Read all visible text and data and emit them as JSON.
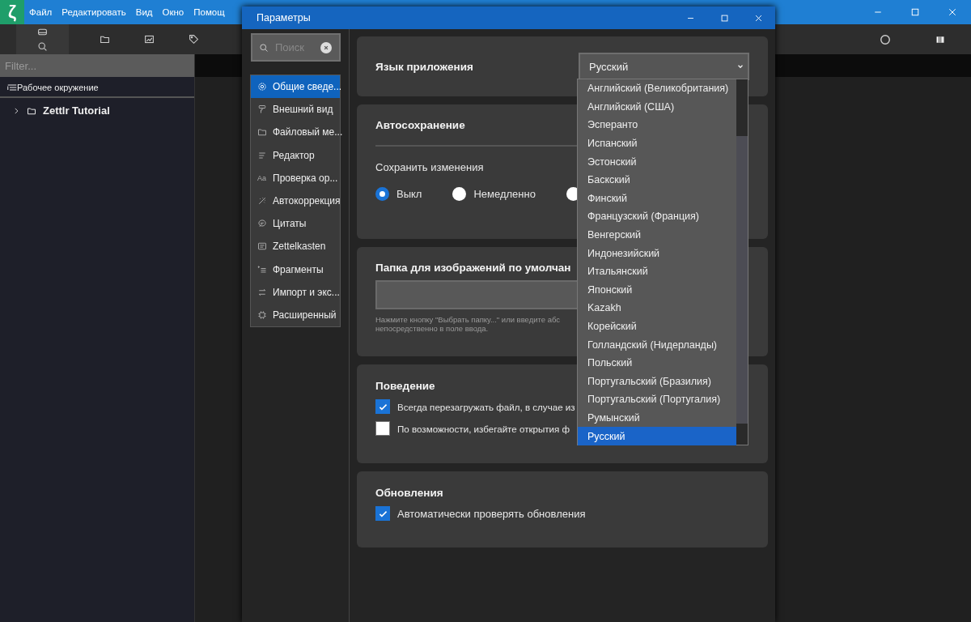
{
  "app": {
    "logo": "ζ",
    "menu": [
      "Файл",
      "Редактировать",
      "Вид",
      "Окно",
      "Помощ"
    ],
    "filter": {
      "placeholder": "Filter..."
    },
    "workspace_header": "Рабочее окружение",
    "tree": [
      {
        "label": "Zettlr Tutorial",
        "expanded": false
      }
    ]
  },
  "dialog": {
    "title": "Параметры",
    "search": {
      "placeholder": "Поиск"
    },
    "nav": [
      {
        "label": "Общие сведе...",
        "kind": "gear",
        "selected": true
      },
      {
        "label": "Внешний вид",
        "kind": "roller",
        "selected": false
      },
      {
        "label": "Файловый ме...",
        "kind": "folder",
        "selected": false
      },
      {
        "label": "Редактор",
        "kind": "lines",
        "selected": false
      },
      {
        "label": "Проверка ор...",
        "kind": "text",
        "icon_text": "Aa",
        "selected": false
      },
      {
        "label": "Автокоррекция",
        "kind": "wand",
        "selected": false
      },
      {
        "label": "Цитаты",
        "kind": "quote",
        "selected": false
      },
      {
        "label": "Zettelkasten",
        "kind": "note",
        "selected": false
      },
      {
        "label": "Фрагменты",
        "kind": "fragments",
        "selected": false
      },
      {
        "label": "Импорт и экс...",
        "kind": "arrows",
        "selected": false
      },
      {
        "label": "Расширенный",
        "kind": "chip",
        "selected": false
      }
    ],
    "language": {
      "title": "Язык приложения",
      "value": "Русский",
      "options": [
        {
          "label": "Английский (Великобритания)",
          "selected": false
        },
        {
          "label": "Английский (США)",
          "selected": false
        },
        {
          "label": "Эсперанто",
          "selected": false
        },
        {
          "label": "Испанский",
          "selected": false
        },
        {
          "label": "Эстонский",
          "selected": false
        },
        {
          "label": "Баскский",
          "selected": false
        },
        {
          "label": "Финский",
          "selected": false
        },
        {
          "label": "Французский (Франция)",
          "selected": false
        },
        {
          "label": "Венгерский",
          "selected": false
        },
        {
          "label": "Индонезийский",
          "selected": false
        },
        {
          "label": "Итальянский",
          "selected": false
        },
        {
          "label": "Японский",
          "selected": false
        },
        {
          "label": "Kazakh",
          "selected": false
        },
        {
          "label": "Корейский",
          "selected": false
        },
        {
          "label": "Голландский (Нидерланды)",
          "selected": false
        },
        {
          "label": "Польский",
          "selected": false
        },
        {
          "label": "Португальский (Бразилия)",
          "selected": false
        },
        {
          "label": "Португальский (Португалия)",
          "selected": false
        },
        {
          "label": "Румынский",
          "selected": false
        },
        {
          "label": "Русский",
          "selected": true
        }
      ]
    },
    "autosave": {
      "title": "Автосохранение",
      "label": "Сохранить изменения",
      "options": [
        {
          "label": "Выкл",
          "selected": true
        },
        {
          "label": "Немедленно",
          "selected": false
        },
        {
          "selected": false
        }
      ]
    },
    "image_folder": {
      "title": "Папка для изображений по умолчан",
      "hint": "Нажмите кнопку \"Выбрать папку...\" или введите абс\nнепосредственно в поле ввода."
    },
    "behaviour": {
      "title": "Поведение",
      "options": [
        {
          "label": "Всегда перезагружать файл, в случае из",
          "checked": true
        },
        {
          "label": "По возможности, избегайте открытия ф",
          "checked": false
        }
      ]
    },
    "updates": {
      "title": "Обновления",
      "options": [
        {
          "label": "Автоматически проверять обновления",
          "checked": true
        }
      ]
    }
  }
}
